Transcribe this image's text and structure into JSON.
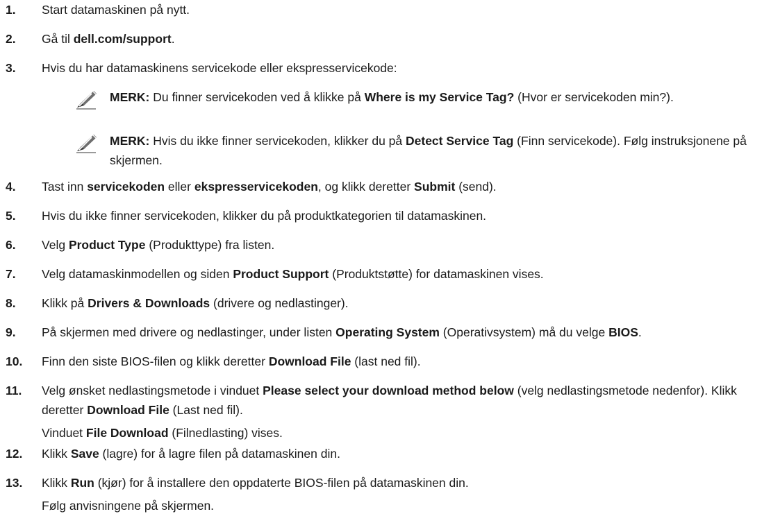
{
  "steps": [
    {
      "n": "1.",
      "parts": [
        {
          "t": "Start datamaskinen på nytt."
        }
      ]
    },
    {
      "n": "2.",
      "parts": [
        {
          "t": "Gå til "
        },
        {
          "t": "dell.com/support",
          "b": true
        },
        {
          "t": "."
        }
      ]
    },
    {
      "n": "3.",
      "parts": [
        {
          "t": "Hvis du har datamaskinens servicekode eller ekspresservicekode:"
        }
      ]
    },
    {
      "n": "4.",
      "parts": [
        {
          "t": "Tast inn "
        },
        {
          "t": "servicekoden",
          "b": true
        },
        {
          "t": " eller "
        },
        {
          "t": "ekspresservicekoden",
          "b": true
        },
        {
          "t": ", og klikk deretter "
        },
        {
          "t": "Submit",
          "b": true
        },
        {
          "t": " (send)."
        }
      ]
    },
    {
      "n": "5.",
      "parts": [
        {
          "t": "Hvis du ikke finner servicekoden, klikker du på produktkategorien til datamaskinen."
        }
      ]
    },
    {
      "n": "6.",
      "parts": [
        {
          "t": "Velg "
        },
        {
          "t": "Product Type",
          "b": true
        },
        {
          "t": " (Produkttype) fra listen."
        }
      ]
    },
    {
      "n": "7.",
      "parts": [
        {
          "t": "Velg datamaskinmodellen og siden "
        },
        {
          "t": "Product Support",
          "b": true
        },
        {
          "t": " (Produktstøtte) for datamaskinen vises."
        }
      ]
    },
    {
      "n": "8.",
      "parts": [
        {
          "t": "Klikk på "
        },
        {
          "t": "Drivers & Downloads",
          "b": true
        },
        {
          "t": " (drivere og nedlastinger)."
        }
      ]
    },
    {
      "n": "9.",
      "parts": [
        {
          "t": "På skjermen med drivere og nedlastinger, under listen "
        },
        {
          "t": "Operating System",
          "b": true
        },
        {
          "t": " (Operativsystem) må du velge "
        },
        {
          "t": "BIOS",
          "b": true
        },
        {
          "t": "."
        }
      ]
    },
    {
      "n": "10.",
      "parts": [
        {
          "t": "Finn den siste BIOS-filen og klikk deretter "
        },
        {
          "t": "Download File",
          "b": true
        },
        {
          "t": " (last ned fil)."
        }
      ]
    },
    {
      "n": "11.",
      "parts": [
        {
          "t": "Velg ønsket nedlastingsmetode i vinduet "
        },
        {
          "t": "Please select your download method below",
          "b": true
        },
        {
          "t": " (velg nedlastingsmetode nedenfor). Klikk deretter "
        },
        {
          "t": "Download File",
          "b": true
        },
        {
          "t": " (Last ned fil)."
        }
      ],
      "after": [
        {
          "t": "Vinduet "
        },
        {
          "t": "File Download",
          "b": true
        },
        {
          "t": " (Filnedlasting) vises."
        }
      ]
    },
    {
      "n": "12.",
      "parts": [
        {
          "t": "Klikk "
        },
        {
          "t": "Save",
          "b": true
        },
        {
          "t": " (lagre) for å lagre filen på datamaskinen din."
        }
      ]
    },
    {
      "n": "13.",
      "parts": [
        {
          "t": "Klikk "
        },
        {
          "t": "Run",
          "b": true
        },
        {
          "t": " (kjør) for å installere den oppdaterte BIOS-filen på datamaskinen din."
        }
      ],
      "after": [
        {
          "t": "Følg anvisningene på skjermen."
        }
      ]
    }
  ],
  "notes": [
    {
      "icon": "note-pencil-icon",
      "parts": [
        {
          "t": "MERK:",
          "b": true
        },
        {
          "t": " Du finner servicekoden ved å klikke på "
        },
        {
          "t": "Where is my Service Tag?",
          "b": true
        },
        {
          "t": " (Hvor er servicekoden min?)."
        }
      ]
    },
    {
      "icon": "note-pencil-icon",
      "parts": [
        {
          "t": "MERK:",
          "b": true
        },
        {
          "t": " Hvis du ikke finner servicekoden, klikker du på "
        },
        {
          "t": "Detect Service Tag",
          "b": true
        },
        {
          "t": " (Finn servicekode). Følg instruksjonene på skjermen."
        }
      ]
    }
  ]
}
